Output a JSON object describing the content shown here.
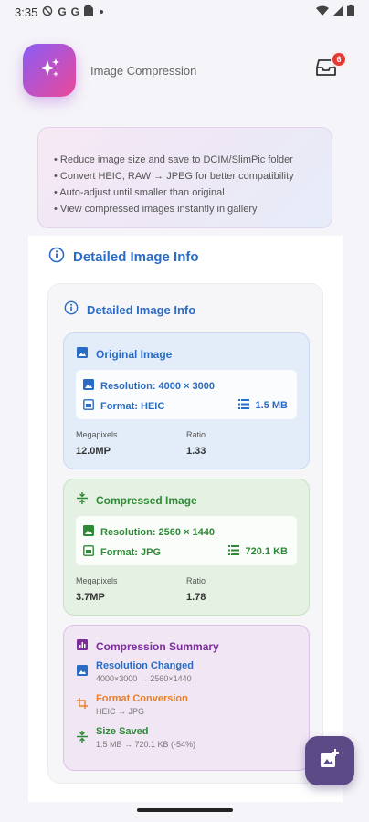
{
  "status_bar": {
    "time": "3:35",
    "icons": [
      "no-disturb-icon",
      "google-icon",
      "google-icon",
      "sim-card-icon",
      "dot-icon"
    ],
    "right_icons": [
      "wifi-icon",
      "signal-icon",
      "battery-icon"
    ],
    "g1": "G",
    "g2": "G"
  },
  "header": {
    "app_title": "Image Compression",
    "badge_count": "6",
    "logo_icon": "sparkles-icon",
    "inbox_icon": "inbox-icon"
  },
  "features": {
    "lines": [
      "• Reduce image size and save to DCIM/SlimPic folder",
      "• Convert HEIC, RAW → JPEG for better compatibility",
      "• Auto-adjust until smaller than original",
      "• View compressed images instantly in gallery"
    ]
  },
  "details": {
    "section_title": "Detailed Image Info",
    "inner_title": "Detailed Image Info",
    "original": {
      "title": "Original Image",
      "resolution": "Resolution: 4000 × 3000",
      "format": "Format: HEIC",
      "size": "1.5 MB",
      "megapixels_label": "Megapixels",
      "megapixels_value": "12.0MP",
      "ratio_label": "Ratio",
      "ratio_value": "1.33"
    },
    "compressed": {
      "title": "Compressed Image",
      "resolution": "Resolution: 2560 × 1440",
      "format": "Format: JPG",
      "size": "720.1 KB",
      "megapixels_label": "Megapixels",
      "megapixels_value": "3.7MP",
      "ratio_label": "Ratio",
      "ratio_value": "1.78"
    },
    "summary": {
      "title": "Compression Summary",
      "items": [
        {
          "title": "Resolution Changed",
          "sub": "4000×3000 → 2560×1440"
        },
        {
          "title": "Format Conversion",
          "sub": "HEIC → JPG"
        },
        {
          "title": "Size Saved",
          "sub": "1.5 MB → 720.1 KB (-54%)"
        }
      ]
    }
  },
  "colors": {
    "accent_blue": "#2a6cc3",
    "accent_green": "#2e8a36",
    "accent_purple": "#7b2d9c",
    "accent_orange": "#e8802a",
    "fab": "#5c4a86"
  }
}
